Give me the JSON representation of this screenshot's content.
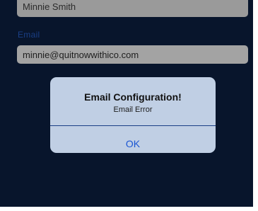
{
  "form": {
    "name_value": "Minnie Smith",
    "email_label": "Email",
    "email_value": "minnie@quitnowwithico.com"
  },
  "alert": {
    "title": "Email Configuration!",
    "message": "Email Error",
    "ok_label": "OK"
  },
  "colors": {
    "background": "#08152c",
    "label": "#1a3f86",
    "alert_bg": "#c0cfe4",
    "alert_button": "#1b56d3"
  }
}
